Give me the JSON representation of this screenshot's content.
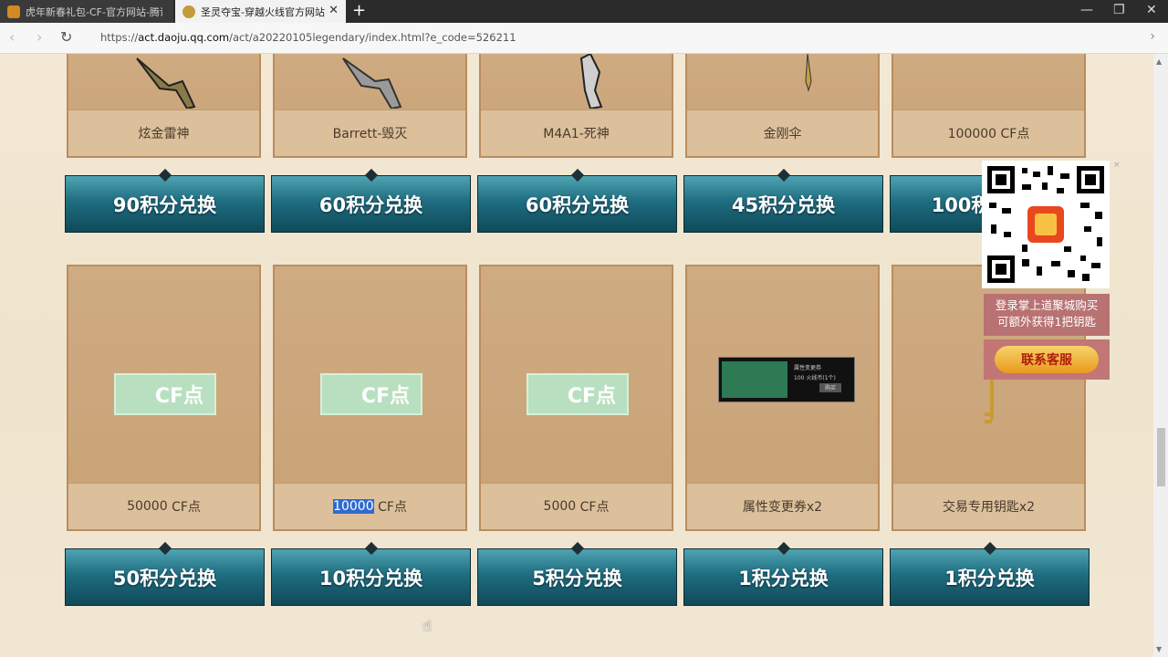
{
  "browser": {
    "tabs": [
      {
        "title": "虎年新春礼包-CF-官方网站-腾讯",
        "active": false
      },
      {
        "title": "圣灵夺宝-穿越火线官方网站",
        "active": true
      }
    ],
    "new_tab_symbol": "+",
    "tab_close_symbol": "✕",
    "window_controls": {
      "minimize": "—",
      "restore": "❐",
      "close": "✕"
    },
    "address": {
      "url_prefix": "https://",
      "url_domain": "act.daoju.qq.com",
      "url_path": "/act/a20220105legendary/index.html?e_code=526211"
    }
  },
  "top_row_items": [
    {
      "name": "炫金雷神",
      "exchange": "90积分兑换"
    },
    {
      "name": "Barrett-毁灭",
      "exchange": "60积分兑换"
    },
    {
      "name": "M4A1-死神",
      "exchange": "60积分兑换"
    },
    {
      "name": "金刚伞",
      "exchange": "45积分兑换"
    },
    {
      "name": "100000 CF点",
      "exchange": "100积分兑换"
    }
  ],
  "bottom_row_items": [
    {
      "name_main": "50000",
      "name_rest": " CF点",
      "chip": "CF点",
      "exchange": "50积分兑换"
    },
    {
      "name_main": "10000",
      "name_rest": " CF点",
      "chip": "CF点",
      "exchange": "10积分兑换",
      "selected": true
    },
    {
      "name_main": "5000",
      "name_rest": " CF点",
      "chip": "CF点",
      "exchange": "5积分兑换"
    },
    {
      "name_main": "属性变更券x2",
      "name_rest": "",
      "exchange": "1积分兑换"
    },
    {
      "name_main": "交易专用钥匙x2",
      "name_rest": "",
      "exchange": "1积分兑换"
    }
  ],
  "voucher": {
    "line1": "属性变更券",
    "line2": "100 火线币(1个)",
    "button": "购买"
  },
  "qr_widget": {
    "line1": "登录掌上道聚城购买",
    "line2": "可额外获得1把钥匙",
    "service_button": "联系客服"
  },
  "colors": {
    "exchange_button": "#1f6d80",
    "selection": "#2e6bd1",
    "service_pill": "#f0b23a"
  }
}
